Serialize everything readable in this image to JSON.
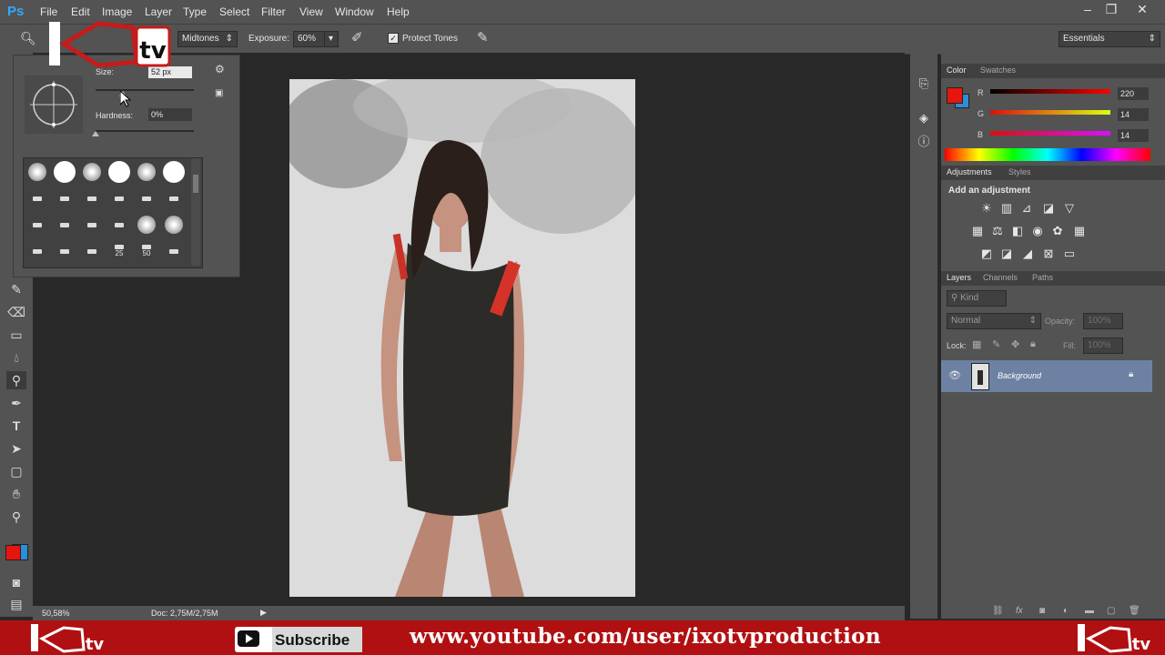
{
  "app": {
    "logo": "Ps"
  },
  "menu": [
    "File",
    "Edit",
    "Image",
    "Layer",
    "Type",
    "Select",
    "Filter",
    "View",
    "Window",
    "Help"
  ],
  "window_buttons": [
    "–",
    "❐",
    "✕"
  ],
  "options": {
    "range_label": "Midtones",
    "exposure_label": "Exposure:",
    "exposure_value": "60%",
    "protect_label": "Protect Tones",
    "protect_checked": true,
    "workspace": "Essentials"
  },
  "brush": {
    "size_label": "Size:",
    "size_value": "52 px",
    "hardness_label": "Hardness:",
    "hardness_value": "0%",
    "preset_labels": [
      "25",
      "50"
    ]
  },
  "status": {
    "zoom": "50,58%",
    "doc": "Doc: 2,75M/2,75M"
  },
  "color_panel": {
    "tabs": [
      "Color",
      "Swatches"
    ],
    "fg": "#e8140e",
    "bg": "#2a8fd6",
    "r_label": "R",
    "r_value": "220",
    "g_label": "G",
    "g_value": "14",
    "b_label": "B",
    "b_value": "14"
  },
  "adjustments": {
    "tabs": [
      "Adjustments",
      "Styles"
    ],
    "title": "Add an adjustment"
  },
  "layers": {
    "tabs": [
      "Layers",
      "Channels",
      "Paths"
    ],
    "filter": "Kind",
    "blend_mode": "Normal",
    "opacity_label": "Opacity:",
    "opacity_value": "100%",
    "lock_label": "Lock:",
    "fill_label": "Fill:",
    "fill_value": "100%",
    "layer_name": "Background"
  },
  "toolbar_colors": {
    "fg": "#e8140e",
    "bg": "#2a8fd6"
  },
  "youtube": {
    "subscribe": "Subscribe",
    "url": "www.youtube.com/user/ixotvproduction",
    "brand": "tv"
  }
}
